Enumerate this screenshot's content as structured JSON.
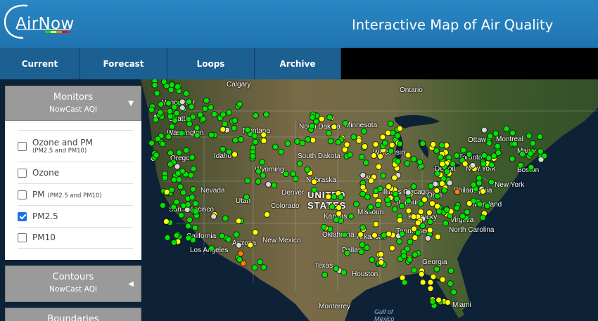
{
  "header": {
    "logo_text": "AirNow",
    "title": "Interactive Map of Air Quality"
  },
  "nav": {
    "tabs": [
      "Current",
      "Forecast",
      "Loops",
      "Archive"
    ]
  },
  "sidebar": {
    "monitors": {
      "title": "Monitors",
      "subtitle": "NowCast AQI",
      "options": [
        {
          "label": "Ozone and PM",
          "sub": "(PM2.5 and PM10)",
          "checked": false
        },
        {
          "label": "Ozone",
          "sub": "",
          "checked": false
        },
        {
          "label": "PM",
          "sub": "(PM2.5 and PM10)",
          "checked": false
        },
        {
          "label": "PM2.5",
          "sub": "",
          "checked": true
        },
        {
          "label": "PM10",
          "sub": "",
          "checked": false
        }
      ]
    },
    "contours": {
      "title": "Contours",
      "subtitle": "NowCast AQI"
    },
    "boundaries": {
      "title": "Boundaries"
    }
  },
  "map": {
    "labels": {
      "calgary": "Calgary",
      "ontario": "Ontario",
      "vancouver": "Vancouver",
      "seattle": "Seattle",
      "washington": "Washington",
      "montana": "Montana",
      "north_dakota": "North Dakota",
      "minnesota": "Minnesota",
      "ottawa": "Ottawa",
      "montreal": "Montreal",
      "maine": "Maine",
      "oregon": "Oregon",
      "idaho": "Idaho",
      "south_dakota": "South Dakota",
      "wisconsin": "Wisconsin",
      "toronto": "Toronto",
      "detroit": "Detroit",
      "new_york_city": "New York",
      "boston": "Boston",
      "wyoming": "Wyoming",
      "nebraska": "Nebraska",
      "iowa": "Iowa",
      "new_york_state": "New York",
      "nevada": "Nevada",
      "utah": "Utah",
      "denver": "Denver",
      "colorado": "Colorado",
      "united": "UNITED",
      "states": "STATES",
      "illinois": "Illinois",
      "chicago": "Chicago",
      "ohio": "Ohio",
      "philadelphia": "Philadelphia",
      "san_francisco": "San Francisco",
      "kansas": "Kansas",
      "missouri": "Missouri",
      "st_louis": "St. Louis",
      "kentucky": "Kentucky",
      "virginia": "Virginia",
      "maryland": "Maryland",
      "california": "California",
      "oklahoma": "Oklahoma",
      "tennessee": "Tennessee",
      "north_carolina": "North Carolina",
      "arizona": "Arizona",
      "new_mexico": "New Mexico",
      "arkansas": "Arkansas",
      "los_angeles": "Los Angeles",
      "dallas": "Dallas",
      "georgia": "Georgia",
      "texas": "Texas",
      "houston": "Houston",
      "gulf": "Gulf of",
      "mexico": "Mexico",
      "monterrey": "Monterrey",
      "miami": "Miami"
    },
    "legend_colors": {
      "good": "#00e400",
      "moderate": "#ffff00",
      "usg": "#ff7e00",
      "no_data": "#d6d6d6"
    }
  }
}
